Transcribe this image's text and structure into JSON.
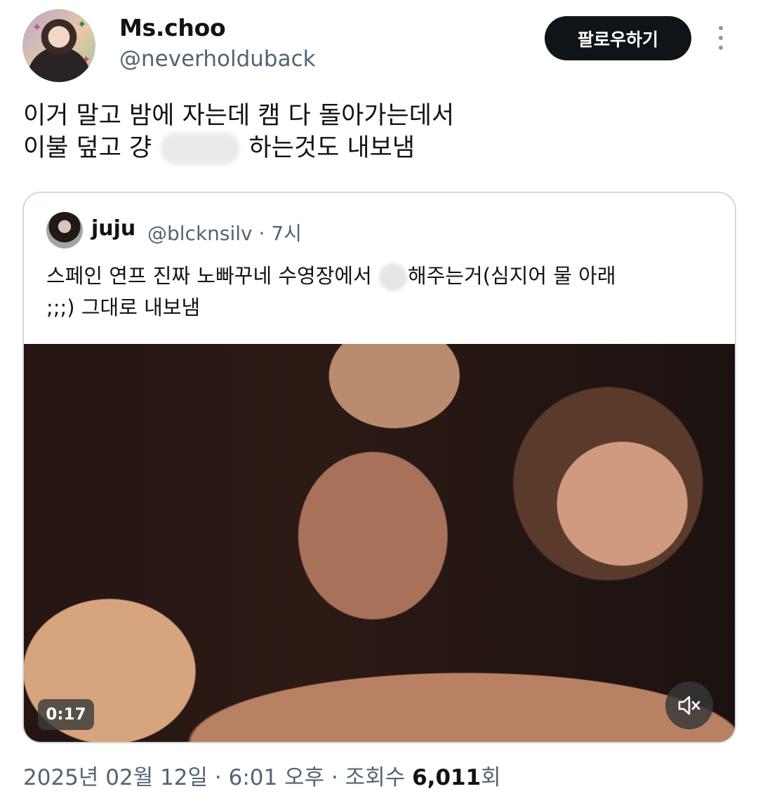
{
  "author": {
    "display_name": "Ms.choo",
    "handle": "@neverholduback"
  },
  "follow_button": {
    "label": "팔로우하기"
  },
  "tweet": {
    "line1": "이거 말고 밤에 자는데 캠 다 돌아가는데서",
    "line2_a": "이불 덮고 걍",
    "line2_b": "하는것도 내보냄"
  },
  "quote": {
    "name": "juju",
    "meta": "@blcknsilv · 7시",
    "line1_a": "스페인 연프 진짜 노빠꾸네 수영장에서 ",
    "line1_b": "해주는거(심지어 물 아래",
    "line2": ";;;) 그대로 내보냄",
    "video": {
      "duration": "0:17",
      "muted": true
    }
  },
  "footer": {
    "date_time": "2025년 02월 12일 · 6:01 오후 · 조회수 ",
    "views": "6,011",
    "views_suffix": "회"
  },
  "colors": {
    "text": "#0f1419",
    "secondary": "#536471",
    "border": "#cfd9de",
    "button_bg": "#0f1419"
  }
}
